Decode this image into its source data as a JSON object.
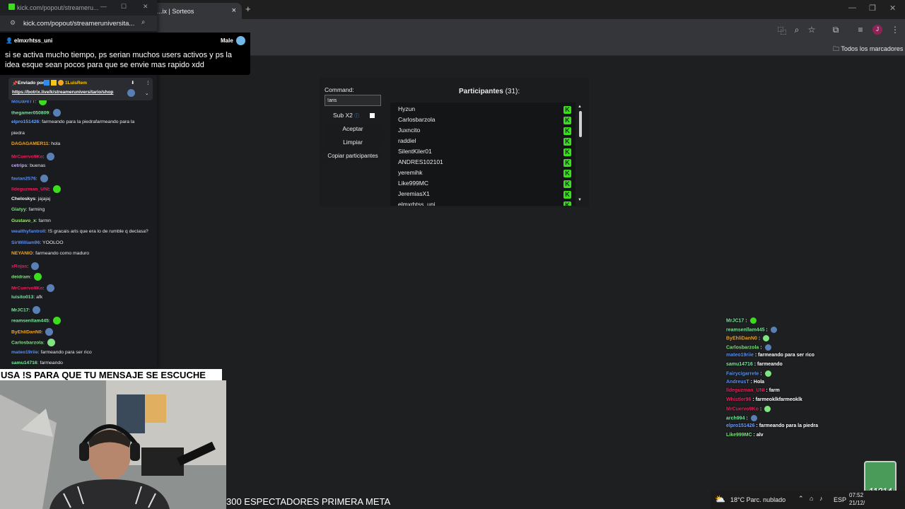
{
  "browser": {
    "tab_title": "...ix | Sorteos",
    "tab_close": "×",
    "new_tab": "+",
    "bookmarks_all": "Todos los marcadores",
    "profile_initial": "J"
  },
  "popout": {
    "title": "kick.com/popout/streameru...",
    "url": "kick.com/popout/streameruniversita...",
    "highlight": {
      "username": "elmxrhtss_uni",
      "gender": "Male",
      "message": "si se activa mucho tiempo, ps serian muchos users activos y ps la idea esque sean pocos para que se envie mas rapido xdd"
    },
    "pinned": {
      "sent_by": "Enviado por",
      "user": "1LuisRem",
      "link": "https://botrix.live/k/streameruniversitario/shop"
    },
    "chat": [
      {
        "user": "MoDaHiTT",
        "color": "#5b8ef0",
        "text": ""
      },
      {
        "user": "thegamer050809",
        "color": "#7fe3a0",
        "text": ""
      },
      {
        "user": "elpro151426",
        "color": "#6aa0ff",
        "text": "farmeando para la piedrafarmeando para la"
      },
      {
        "user": "",
        "color": "#e8eaed",
        "text": "piedra"
      },
      {
        "user": "DAGAGAMER11",
        "color": "#f5a623",
        "text": "hola"
      },
      {
        "user": "MrCuervo9Ko",
        "color": "#e0245e",
        "text": ""
      },
      {
        "user": "cetrips",
        "color": "#c9a8ff",
        "text": "buenas"
      },
      {
        "user": "favian2576",
        "color": "#5b8ef0",
        "text": ""
      },
      {
        "user": "lldeguzman_UNI",
        "color": "#e0245e",
        "text": ""
      },
      {
        "user": "Cheloskys",
        "color": "#f5f5f5",
        "text": "jajajaj"
      },
      {
        "user": "Giatyy",
        "color": "#7fe37f",
        "text": "farming"
      },
      {
        "user": "Gustavo_x",
        "color": "#9ef06a",
        "text": "farmn"
      },
      {
        "user": "wealthyfantroll",
        "color": "#5b8ef0",
        "text": "!S gracais aris que era lo de rumble q declasa?"
      },
      {
        "user": "SirWilliam96",
        "color": "#5b8ef0",
        "text": "YOOLOO"
      },
      {
        "user": "NEYANIO",
        "color": "#f5a623",
        "text": "farmeando como maduro"
      },
      {
        "user": "xRojas",
        "color": "#e0245e",
        "text": ""
      },
      {
        "user": "deidram",
        "color": "#7fe37f",
        "text": ""
      },
      {
        "user": "MrCuervo9Ko",
        "color": "#e0245e",
        "text": ""
      },
      {
        "user": "luisito013",
        "color": "#7fe3a0",
        "text": "afk"
      },
      {
        "user": "MrJC17",
        "color": "#7fe3a0",
        "text": ""
      },
      {
        "user": "reamsenllam445",
        "color": "#7fe3a0",
        "text": ""
      },
      {
        "user": "ByEhliDanN0",
        "color": "#f5a623",
        "text": ""
      },
      {
        "user": "Carlosbarzola",
        "color": "#7fe37f",
        "text": ""
      },
      {
        "user": "mateo19riie",
        "color": "#5b8ef0",
        "text": "farmeando para ser rico"
      },
      {
        "user": "samu14716",
        "color": "#7fe3a0",
        "text": "farmeando"
      }
    ]
  },
  "sorteo": {
    "command_label": "Command:",
    "command_value": "!aris",
    "sub_label": "Sub X2",
    "accept": "Aceptar",
    "clear": "Limpiar",
    "copy": "Copiar participantes",
    "participants_label": "Participantes",
    "participants_count": "(31):",
    "participants": [
      "Hyzun",
      "Carlosbarzola",
      "Juxncito",
      "raddiel",
      "SilentKiler01",
      "ANDRES102101",
      "yeremihk",
      "Like999MC",
      "JeremiasX1",
      "elmxrhtss_uni"
    ]
  },
  "overlay_chat": [
    {
      "user": "MrJC17",
      "color": "#7fe3a0",
      "text": ""
    },
    {
      "user": "reamsenllam445",
      "color": "#7fe3a0",
      "text": ""
    },
    {
      "user": "ByEhliDanN0",
      "color": "#f5a623",
      "text": ""
    },
    {
      "user": "Carlosbarzola",
      "color": "#7fe37f",
      "text": ""
    },
    {
      "user": "mateo19riie",
      "color": "#5b8ef0",
      "text": "farmeando para ser rico"
    },
    {
      "user": "samu14716",
      "color": "#7fe3a0",
      "text": "farmeando"
    },
    {
      "user": "Fairycigarrete",
      "color": "#5b8ef0",
      "text": ""
    },
    {
      "user": "AndreusT",
      "color": "#5b8ef0",
      "text": "Hola"
    },
    {
      "user": "lldeguzman_UNI",
      "color": "#e0245e",
      "text": "farm"
    },
    {
      "user": "Whistler96",
      "color": "#e0245e",
      "text": "farmeoklkfarmeoklk"
    },
    {
      "user": "MrCuervo9Ko",
      "color": "#e0245e",
      "text": ""
    },
    {
      "user": "arch994",
      "color": "#7fe3a0",
      "text": ""
    },
    {
      "user": "elpro151426",
      "color": "#6aa0ff",
      "text": "farmeando para la piedra"
    },
    {
      "user": "Like999MC",
      "color": "#7fe37f",
      "text": "alv"
    }
  ],
  "stream": {
    "banner": "USA !S PARA QUE TU MENSAJE SE ESCUCHE",
    "ticker": "300 ESPECTADORES PRIMERA META",
    "counter": "11314"
  },
  "taskbar": {
    "weather": "18°C  Parc. nublado",
    "lang": "ESP",
    "time": "07:52",
    "date": "21/12/"
  }
}
